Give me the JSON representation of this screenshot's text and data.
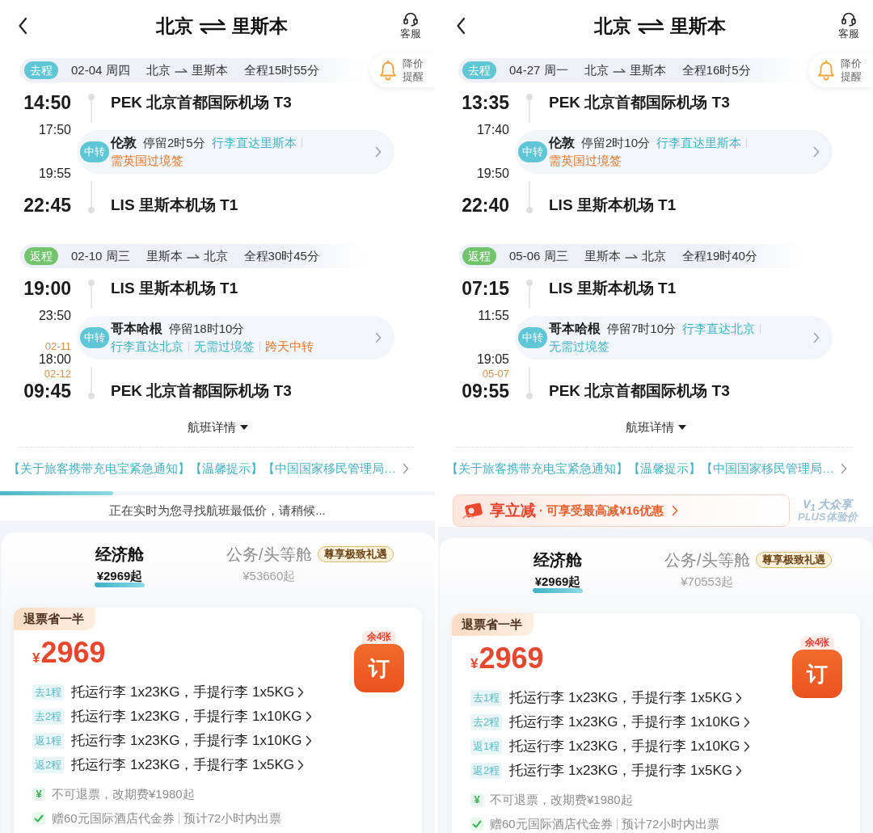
{
  "screens": [
    {
      "header": {
        "origin": "北京",
        "destination": "里斯本",
        "service_label": "客服"
      },
      "price_alert": {
        "label": "降价提醒"
      },
      "legs": [
        {
          "tag": "去程",
          "color": "#5ec6d4",
          "date": "02-04 周四",
          "from": "北京",
          "to": "里斯本",
          "duration": "全程15时55分",
          "departure": {
            "time": "14:50",
            "airport": "PEK 北京首都国际机场 T3"
          },
          "transfer": {
            "tag": "中转",
            "arrive_time": "17:50",
            "depart_time": "19:55",
            "city": "伦敦",
            "stay": "停留2时5分",
            "first_line_notes": [
              {
                "text": "行李直达里斯本",
                "kind": "info"
              }
            ],
            "second_line_notes": [
              {
                "text": "需英国过境签",
                "kind": "warning"
              }
            ]
          },
          "arrival": {
            "time": "22:45",
            "airport": "LIS 里斯本机场 T1"
          }
        },
        {
          "tag": "返程",
          "color": "#72c46c",
          "date": "02-10 周三",
          "from": "里斯本",
          "to": "北京",
          "duration": "全程30时45分",
          "departure": {
            "time": "19:00",
            "airport": "LIS 里斯本机场 T1"
          },
          "transfer": {
            "tag": "中转",
            "arrive_time": "23:50",
            "depart_date": "02-11",
            "depart_time": "18:00",
            "city": "哥本哈根",
            "stay": "停留18时10分",
            "second_line_notes": [
              {
                "text": "行李直达北京",
                "kind": "info"
              },
              {
                "text": "无需过境签",
                "kind": "info"
              },
              {
                "text": "跨天中转",
                "kind": "warning"
              }
            ]
          },
          "arrival": {
            "date": "02-12",
            "time": "09:45",
            "airport": "PEK 北京首都国际机场 T3"
          }
        }
      ],
      "details_label": "航班详情",
      "notice": "【关于旅客携带充电宝紧急通知】【温馨提示】【中国国家移民管理局…",
      "loading": {
        "level": 0.26,
        "text": "正在实时为您寻找航班最低价，请稍候..."
      },
      "cabins": [
        {
          "label": "经济舱",
          "price": "¥2969起",
          "selected": true
        },
        {
          "label": "公务/头等舱",
          "price": "¥53660起",
          "selected": false,
          "badge": "尊享极致礼遇"
        }
      ],
      "fare": {
        "tag": "退票省一半",
        "currency": "¥",
        "price": "2969",
        "stock": "余4张",
        "book_label": "订",
        "baggage": [
          {
            "segment": "去1程",
            "text": "托运行李 1x23KG，手提行李 1x5KG"
          },
          {
            "segment": "去2程",
            "text": "托运行李 1x23KG，手提行李 1x10KG"
          },
          {
            "segment": "返1程",
            "text": "托运行李 1x23KG，手提行李 1x10KG"
          },
          {
            "segment": "返2程",
            "text": "托运行李 1x23KG，手提行李 1x5KG"
          }
        ],
        "policies": [
          {
            "kind": "yen",
            "symbol": "¥",
            "parts": [
              "不可退票，改期费¥1980起"
            ]
          },
          {
            "kind": "check",
            "parts": [
              "赠60元国际酒店代金券",
              "预计72小时内出票"
            ]
          }
        ]
      }
    },
    {
      "header": {
        "origin": "北京",
        "destination": "里斯本",
        "service_label": "客服"
      },
      "price_alert": {
        "label": "降价提醒"
      },
      "legs": [
        {
          "tag": "去程",
          "color": "#5ec6d4",
          "date": "04-27 周一",
          "from": "北京",
          "to": "里斯本",
          "duration": "全程16时5分",
          "departure": {
            "time": "13:35",
            "airport": "PEK 北京首都国际机场 T3"
          },
          "transfer": {
            "tag": "中转",
            "arrive_time": "17:40",
            "depart_time": "19:50",
            "city": "伦敦",
            "stay": "停留2时10分",
            "first_line_notes": [
              {
                "text": "行李直达里斯本",
                "kind": "info"
              }
            ],
            "second_line_notes": [
              {
                "text": "需英国过境签",
                "kind": "warning"
              }
            ]
          },
          "arrival": {
            "time": "22:40",
            "airport": "LIS 里斯本机场 T1"
          }
        },
        {
          "tag": "返程",
          "color": "#72c46c",
          "date": "05-06 周三",
          "from": "里斯本",
          "to": "北京",
          "duration": "全程19时40分",
          "departure": {
            "time": "07:15",
            "airport": "LIS 里斯本机场 T1"
          },
          "transfer": {
            "tag": "中转",
            "arrive_time": "11:55",
            "depart_time": "19:05",
            "city": "哥本哈根",
            "stay": "停留7时10分",
            "first_line_notes": [
              {
                "text": "行李直达北京",
                "kind": "info"
              }
            ],
            "second_line_notes": [
              {
                "text": "无需过境签",
                "kind": "info"
              }
            ]
          },
          "arrival": {
            "date": "05-07",
            "time": "09:55",
            "airport": "PEK 北京首都国际机场 T3"
          }
        }
      ],
      "details_label": "航班详情",
      "notice": "【关于旅客携带充电宝紧急通知】【温馨提示】【中国国家移民管理局…",
      "promo": {
        "title": "享立减",
        "text": "· 可享受最高减¥16优惠",
        "plus_top": "V$_{1}$ 大众享",
        "plus_bottom": "PLUS体验价"
      },
      "cabins": [
        {
          "label": "经济舱",
          "price": "¥2969起",
          "selected": true
        },
        {
          "label": "公务/头等舱",
          "price": "¥70553起",
          "selected": false,
          "badge": "尊享极致礼遇"
        }
      ],
      "fare": {
        "tag": "退票省一半",
        "currency": "¥",
        "price": "2969",
        "stock": "余4张",
        "book_label": "订",
        "baggage": [
          {
            "segment": "去1程",
            "text": "托运行李 1x23KG，手提行李 1x5KG"
          },
          {
            "segment": "去2程",
            "text": "托运行李 1x23KG，手提行李 1x10KG"
          },
          {
            "segment": "返1程",
            "text": "托运行李 1x23KG，手提行李 1x10KG"
          },
          {
            "segment": "返2程",
            "text": "托运行李 1x23KG，手提行李 1x5KG"
          }
        ],
        "policies": [
          {
            "kind": "yen",
            "symbol": "¥",
            "parts": [
              "不可退票，改期费¥1980起"
            ]
          },
          {
            "kind": "check",
            "parts": [
              "赠60元国际酒店代金券",
              "预计72小时内出票"
            ]
          }
        ]
      }
    }
  ]
}
